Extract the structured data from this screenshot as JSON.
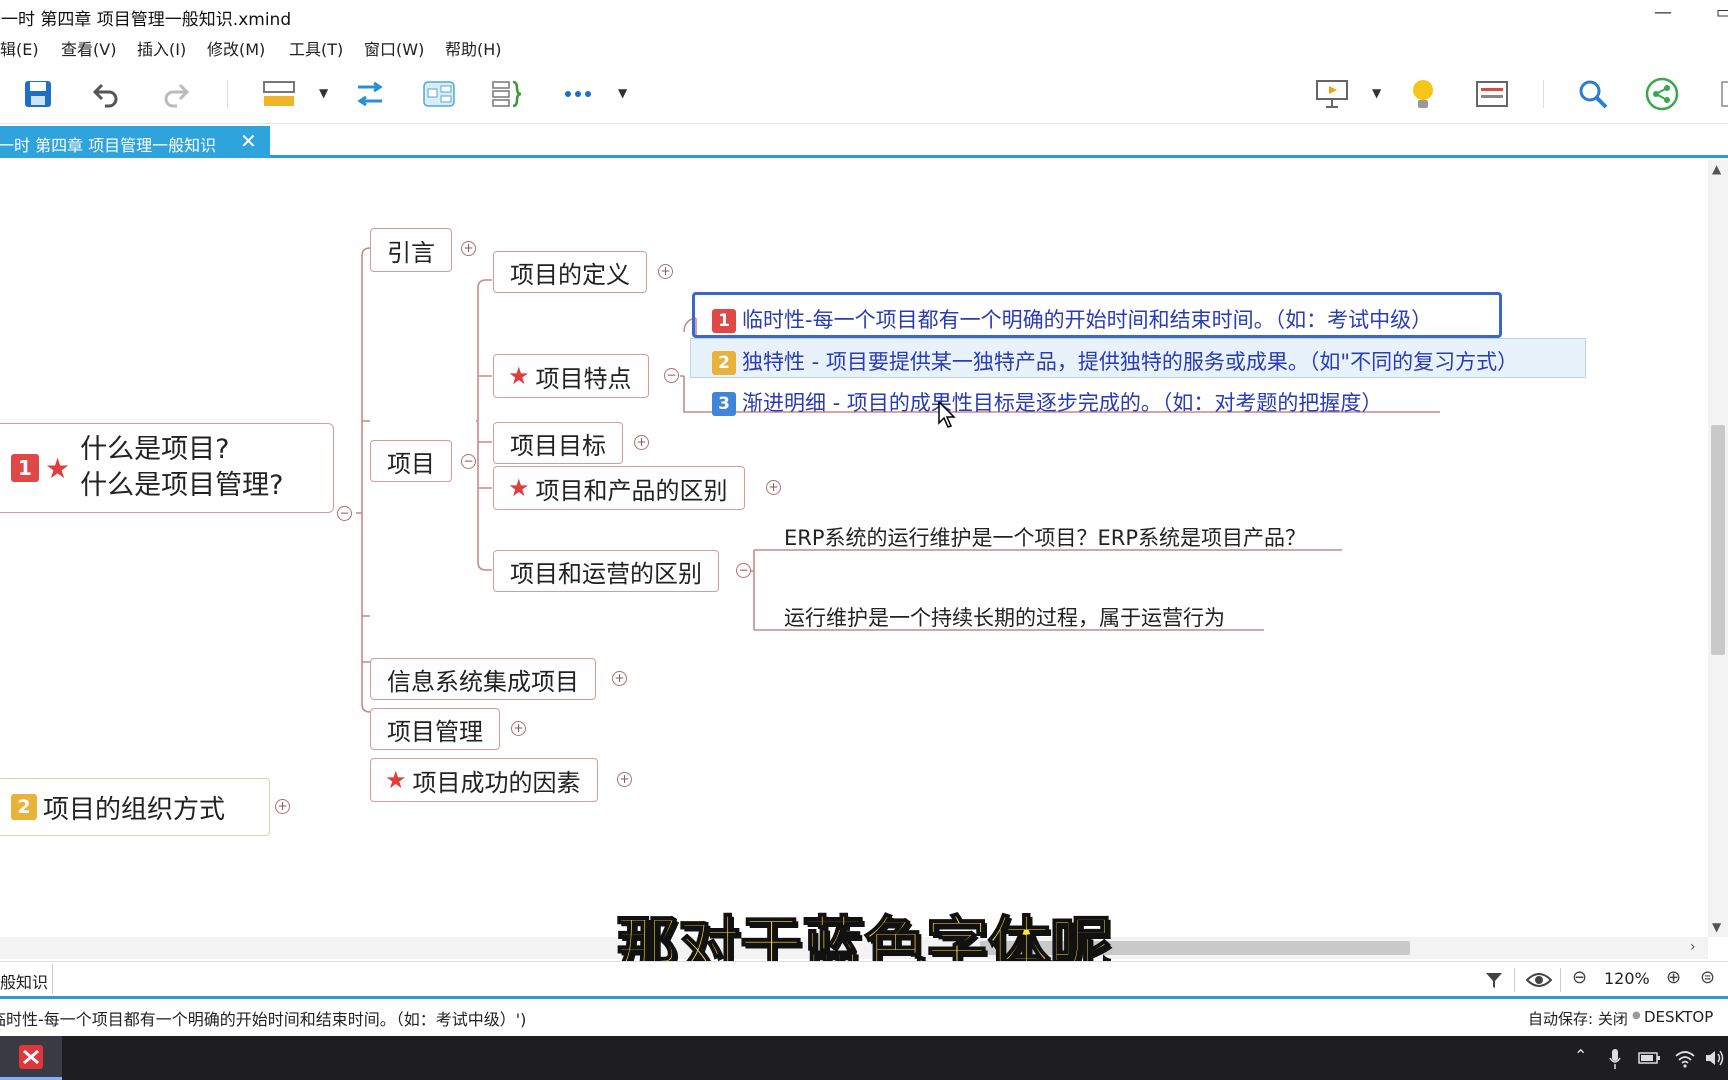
{
  "window": {
    "title": "第一时 第四章 项目管理一般知识.xmind"
  },
  "menu": [
    "编辑(E)",
    "查看(V)",
    "插入(I)",
    "修改(M)",
    "工具(T)",
    "窗口(W)",
    "帮助(H)"
  ],
  "toolbar": {
    "icons": [
      "save-icon",
      "undo-icon",
      "redo-icon",
      "topic-style-icon",
      "relationship-icon",
      "boundary-icon",
      "summary-icon",
      "more-icon",
      "presentation-icon",
      "idea-icon",
      "panel-icon",
      "search-icon",
      "share-icon"
    ]
  },
  "tab": {
    "label": "第一时 第四章 项目管理一般知识",
    "close": "✕"
  },
  "mindmap": {
    "root1": {
      "badge": "1",
      "line1": "什么是项目?",
      "line2": "什么是项目管理?"
    },
    "root2": {
      "badge": "2",
      "label": "项目的组织方式"
    },
    "level1": {
      "yinyan": "引言",
      "xiangmu": "项目",
      "xinxi": "信息系统集成项目",
      "guanli": "项目管理",
      "chenggong": "项目成功的因素"
    },
    "level2": {
      "dingyi": "项目的定义",
      "tedian": "项目特点",
      "mubiao": "项目目标",
      "chanpin": "项目和产品的区别",
      "yunying": "项目和运营的区别"
    },
    "tedian_items": [
      {
        "badge": "1",
        "text": "临时性-每一个项目都有一个明确的开始时间和结束时间。（如：考试中级）"
      },
      {
        "badge": "2",
        "text": "独特性 - 项目要提供某一独特产品，提供独特的服务或成果。（如\"不同的复习方式）"
      },
      {
        "badge": "3",
        "text": "渐进明细 - 项目的成果性目标是逐步完成的。（如：对考题的把握度）"
      }
    ],
    "yunying_items": [
      "ERP系统的运行维护是一个项目？ERP系统是项目产品？",
      "运行维护是一个持续长期的过程，属于运营行为"
    ]
  },
  "bottom": {
    "sheet": "一般知识",
    "zoom": "120%"
  },
  "status": {
    "text": "临时性-每一个项目都有一个明确的开始时间和结束时间。（如：考试中级）')",
    "autosave": "自动保存: 关闭",
    "machine": "DESKTOP"
  },
  "subtitle": "那对于蓝色字体呢"
}
